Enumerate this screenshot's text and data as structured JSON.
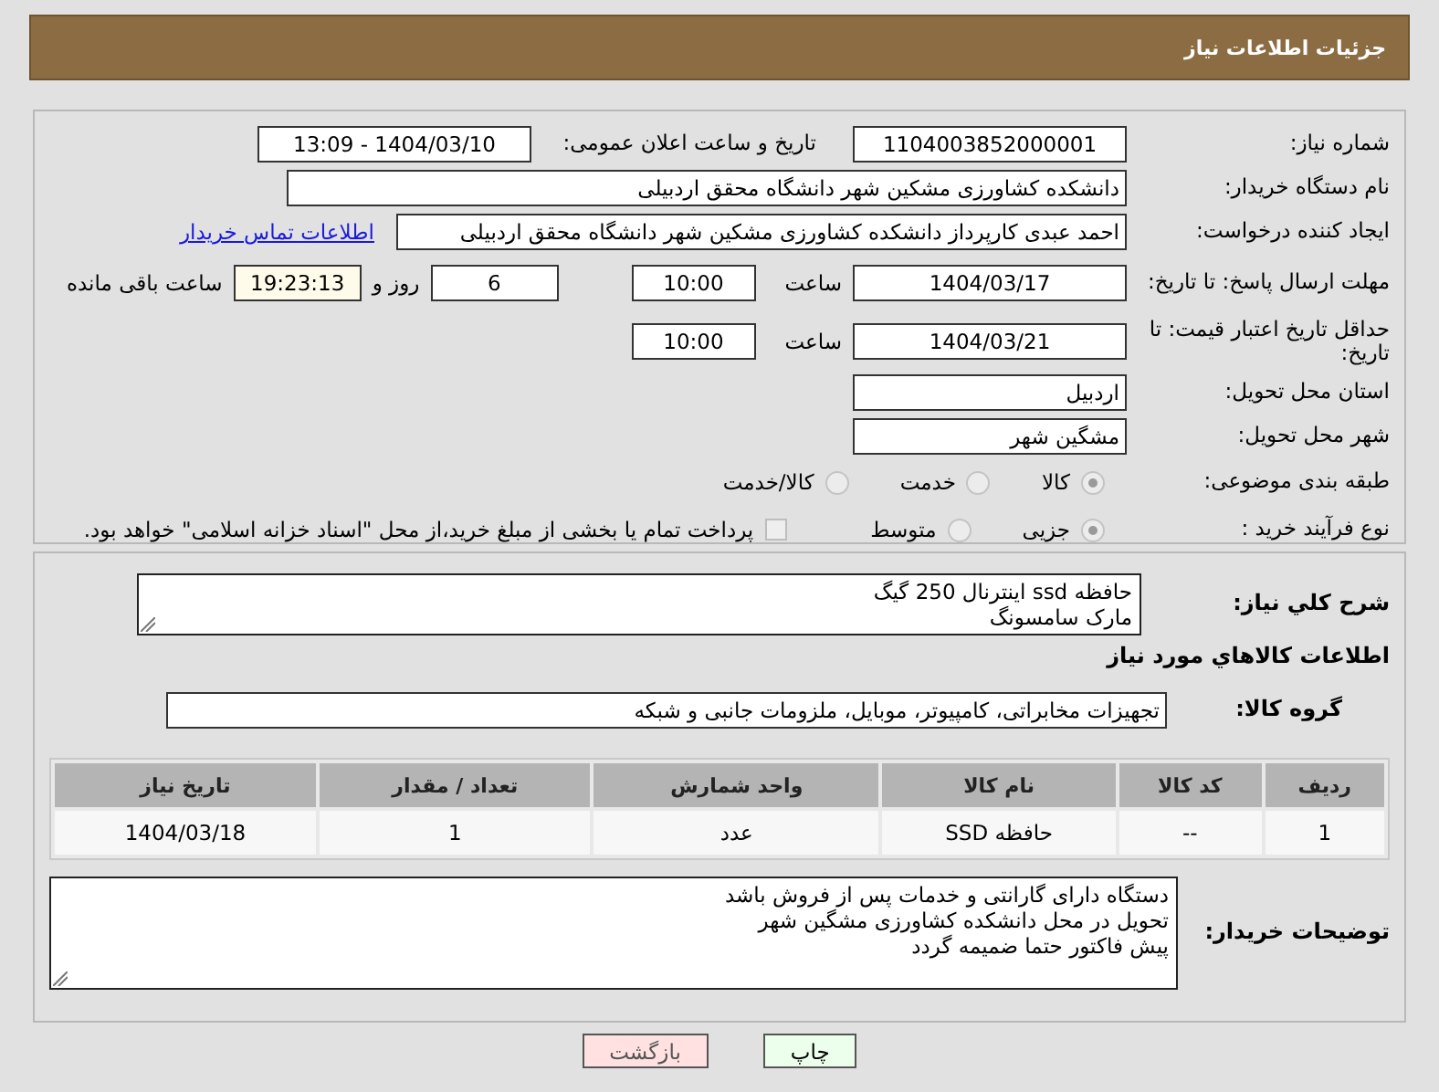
{
  "header": {
    "title": "جزئیات اطلاعات نیاز"
  },
  "need_number": {
    "label": "شماره نیاز:",
    "value": "1104003852000001"
  },
  "announce": {
    "label": "تاریخ و ساعت اعلان عمومی:",
    "value": "1404/03/10 - 13:09"
  },
  "buyer_org": {
    "label": "نام دستگاه خریدار:",
    "value": "دانشکده کشاورزی مشکین شهر دانشگاه محقق اردبیلی"
  },
  "requester": {
    "label": "ایجاد کننده درخواست:",
    "value": "احمد عبدی کارپرداز دانشکده کشاورزی مشکین شهر دانشگاه محقق اردبیلی",
    "link": "اطلاعات تماس خریدار"
  },
  "reply_deadline": {
    "label": "مهلت ارسال پاسخ: تا تاریخ:",
    "date": "1404/03/17",
    "time_label": "ساعت",
    "time": "10:00",
    "days": "6",
    "days_label": "روز و",
    "remaining": "19:23:13",
    "remaining_label": "ساعت باقی مانده"
  },
  "price_validity": {
    "label": "حداقل تاریخ اعتبار قیمت: تا تاریخ:",
    "date": "1404/03/21",
    "time_label": "ساعت",
    "time": "10:00"
  },
  "province": {
    "label": "استان محل تحویل:",
    "value": "اردبیل"
  },
  "city": {
    "label": "شهر محل تحویل:",
    "value": "مشگین شهر"
  },
  "category": {
    "label": "طبقه بندی موضوعی:",
    "options": [
      {
        "label": "کالا",
        "selected": true
      },
      {
        "label": "خدمت",
        "selected": false
      },
      {
        "label": "کالا/خدمت",
        "selected": false
      }
    ]
  },
  "process": {
    "label": "نوع فرآیند خرید :",
    "options": [
      {
        "label": "جزیی",
        "selected": true
      },
      {
        "label": "متوسط",
        "selected": false
      }
    ],
    "payment_note": {
      "label": "پرداخت تمام یا بخشی از مبلغ خرید،از محل \"اسناد خزانه اسلامی\" خواهد بود.",
      "checked": false
    }
  },
  "description": {
    "label": "شرح کلي نياز:",
    "lines": [
      "حافظه ssd اینترنال 250 گیگ",
      "مارک سامسونگ"
    ]
  },
  "goods_title": "اطلاعات کالاهاي مورد نياز",
  "goods_group": {
    "label": "گروه کالا:",
    "value": "تجهیزات مخابراتی، کامپیوتر، موبایل، ملزومات جانبی و شبکه"
  },
  "table": {
    "columns": [
      "ردیف",
      "کد کالا",
      "نام کالا",
      "واحد شمارش",
      "تعداد / مقدار",
      "تاریخ نیاز"
    ],
    "rows": [
      [
        "1",
        "--",
        "حافظه SSD",
        "عدد",
        "1",
        "1404/03/18"
      ]
    ]
  },
  "buyer_notes": {
    "label": "توضیحات خریدار:",
    "lines": [
      "دستگاه دارای گارانتی و خدمات پس از فروش باشد",
      "تحویل در محل دانشکده کشاورزی مشگین شهر",
      "پیش فاکتور حتما ضمیمه گردد"
    ]
  },
  "buttons": [
    {
      "label": "چاپ",
      "kind": "print"
    },
    {
      "label": "بازگشت",
      "kind": "back"
    }
  ]
}
